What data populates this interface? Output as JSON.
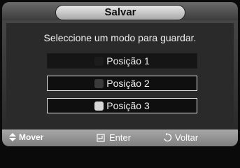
{
  "dialog": {
    "title": "Salvar",
    "prompt": "Seleccione um modo para guardar."
  },
  "slots": [
    {
      "label": "Posição 1"
    },
    {
      "label": "Posição 2"
    },
    {
      "label": "Posição 3"
    }
  ],
  "statusbar": {
    "move": {
      "label": "Mover",
      "icon": "up-down-arrows-icon"
    },
    "enter": {
      "label": "Enter",
      "icon": "enter-icon"
    },
    "back": {
      "label": "Voltar",
      "icon": "return-icon"
    }
  }
}
